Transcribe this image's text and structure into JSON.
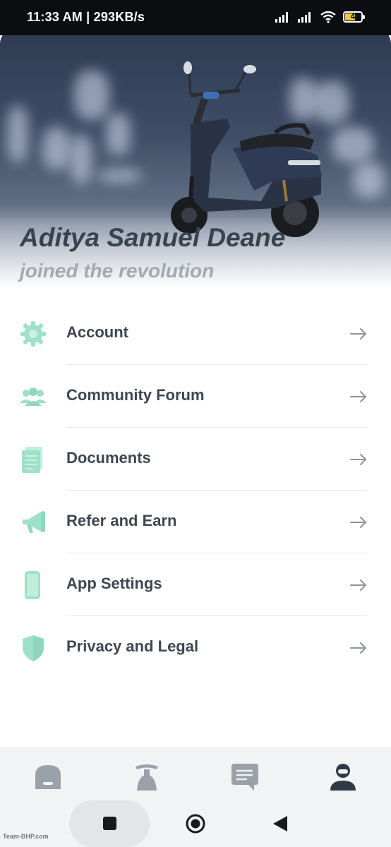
{
  "status_bar": {
    "time_speed": "11:33 AM | 293KB/s",
    "battery_level": "4",
    "icons": [
      "signal-icon",
      "signal-icon",
      "wifi-icon",
      "battery-icon"
    ]
  },
  "profile": {
    "name": "Aditya Samuel Deane",
    "subtitle": "joined the revolution"
  },
  "menu": [
    {
      "label": "Account",
      "icon": "gear-icon"
    },
    {
      "label": "Community Forum",
      "icon": "people-icon"
    },
    {
      "label": "Documents",
      "icon": "documents-icon"
    },
    {
      "label": "Refer and Earn",
      "icon": "megaphone-icon"
    },
    {
      "label": "App Settings",
      "icon": "phone-icon"
    },
    {
      "label": "Privacy and Legal",
      "icon": "shield-icon"
    }
  ],
  "bottom_nav": [
    {
      "name": "home",
      "icon": "home-icon",
      "active": false
    },
    {
      "name": "scooter",
      "icon": "scooter-icon",
      "active": false
    },
    {
      "name": "messages",
      "icon": "chat-icon",
      "active": false
    },
    {
      "name": "profile",
      "icon": "profile-icon",
      "active": true
    }
  ],
  "colors": {
    "accent_mint": "#a8e6d0",
    "text_dark": "#3d4752",
    "text_muted": "#a3a9b0",
    "nav_inactive": "#9aa1a8",
    "nav_active": "#2f3a46"
  },
  "watermark": "Team-BHP.com"
}
